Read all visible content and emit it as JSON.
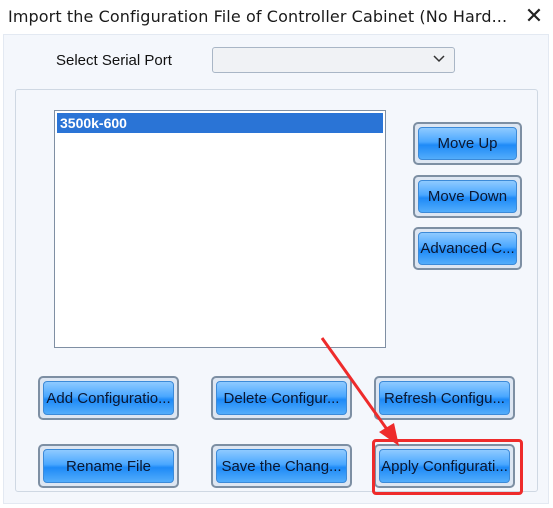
{
  "window": {
    "title": "Import the Configuration File of Controller Cabinet (No Hard...",
    "close_glyph": "✕"
  },
  "serial_port": {
    "label": "Select Serial Port",
    "value": ""
  },
  "config_list": {
    "items": [
      "3500k-600"
    ],
    "selected_index": 0
  },
  "side_buttons": {
    "move_up": "Move Up",
    "move_down": "Move Down",
    "advanced": "Advanced C..."
  },
  "bottom_buttons": {
    "add": "Add Configuratio...",
    "delete": "Delete Configur...",
    "refresh": "Refresh Configu...",
    "rename": "Rename File",
    "save": "Save the Chang...",
    "apply": "Apply Configurati..."
  },
  "annotation": {
    "color": "#ee2b2b",
    "target": "apply-configuration-button"
  }
}
